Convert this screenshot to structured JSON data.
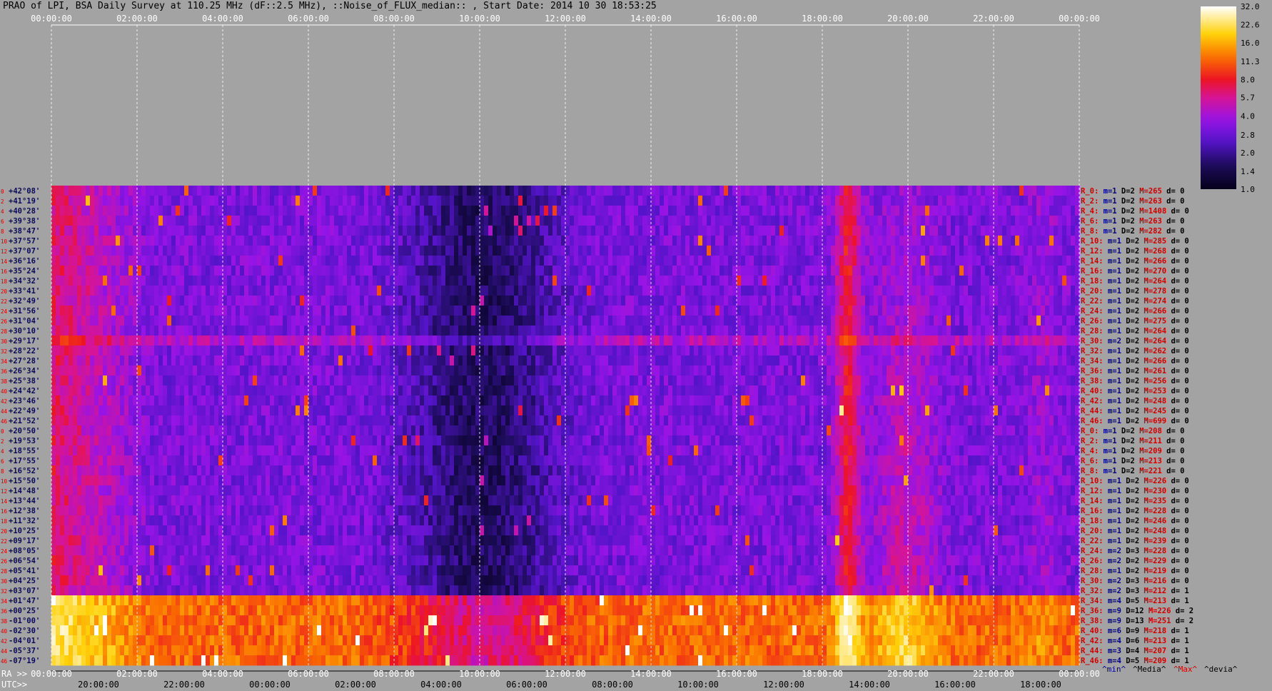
{
  "title": "PRAO of LPI, BSA Daily Survey at 110.25 MHz (dF::2.5 MHz), ::Noise_of_FLUX_median:: , Start Date: 2014 10 30 18:53:25",
  "chart_data": {
    "type": "heatmap",
    "top_time_ticks": [
      "00:00:00",
      "02:00:00",
      "04:00:00",
      "06:00:00",
      "08:00:00",
      "10:00:00",
      "12:00:00",
      "14:00:00",
      "16:00:00",
      "18:00:00",
      "20:00:00",
      "22:00:00",
      "00:00:00"
    ],
    "ra_row_label": "RA >>",
    "ra_ticks": [
      "00:00:00",
      "02:00:00",
      "04:00:00",
      "06:00:00",
      "08:00:00",
      "10:00:00",
      "12:00:00",
      "14:00:00",
      "16:00:00",
      "18:00:00",
      "20:00:00",
      "22:00:00",
      "00:00:00"
    ],
    "utc_row_label": "UTC>>",
    "utc_ticks": [
      "20:00:00",
      "22:00:00",
      "00:00:00",
      "02:00:00",
      "04:00:00",
      "06:00:00",
      "08:00:00",
      "10:00:00",
      "12:00:00",
      "14:00:00",
      "16:00:00",
      "18:00:00"
    ],
    "declinations": [
      "+42°08'",
      "+41°19'",
      "+40°28'",
      "+39°38'",
      "+38°47'",
      "+37°57'",
      "+37°07'",
      "+36°16'",
      "+35°24'",
      "+34°32'",
      "+33°41'",
      "+32°49'",
      "+31°56'",
      "+31°04'",
      "+30°10'",
      "+29°17'",
      "+28°22'",
      "+27°28'",
      "+26°34'",
      "+25°38'",
      "+24°42'",
      "+23°46'",
      "+22°49'",
      "+21°52'",
      "+20°50'",
      "+19°53'",
      "+18°55'",
      "+17°55'",
      "+16°52'",
      "+15°50'",
      "+14°48'",
      "+13°44'",
      "+12°38'",
      "+11°32'",
      "+10°25'",
      "+09°17'",
      "+08°05'",
      "+06°54'",
      "+05°41'",
      "+04°25'",
      "+03°07'",
      "+01°47'",
      "+00°25'",
      "-01°00'",
      "-02°30'",
      "-04°01'",
      "-05°37'",
      "-07°19'"
    ],
    "beam_numbers": [
      "0",
      "2",
      "4",
      "6",
      "8",
      "10",
      "12",
      "14",
      "16",
      "18",
      "20",
      "22",
      "24",
      "26",
      "28",
      "30",
      "32",
      "34",
      "36",
      "38",
      "40",
      "42",
      "44",
      "46",
      "0",
      "2",
      "4",
      "6",
      "8",
      "10",
      "12",
      "14",
      "16",
      "18",
      "20",
      "22",
      "24",
      "26",
      "28",
      "30",
      "32",
      "34",
      "36",
      "38",
      "40",
      "42",
      "44",
      "46"
    ],
    "row_stats": [
      {
        "r": "R_0:",
        "m": "m=1",
        "D": "D=2",
        "M": "M=265",
        "d": "d= 0"
      },
      {
        "r": "R_2:",
        "m": "m=1",
        "D": "D=2",
        "M": "M=263",
        "d": "d= 0"
      },
      {
        "r": "R_4:",
        "m": "m=1",
        "D": "D=2",
        "M": "M=1408",
        "d": "d= 0"
      },
      {
        "r": "R_6:",
        "m": "m=1",
        "D": "D=2",
        "M": "M=263",
        "d": "d= 0"
      },
      {
        "r": "R_8:",
        "m": "m=1",
        "D": "D=2",
        "M": "M=282",
        "d": "d= 0"
      },
      {
        "r": "R_10:",
        "m": "m=1",
        "D": "D=2",
        "M": "M=285",
        "d": "d= 0"
      },
      {
        "r": "R_12:",
        "m": "m=1",
        "D": "D=2",
        "M": "M=268",
        "d": "d= 0"
      },
      {
        "r": "R_14:",
        "m": "m=1",
        "D": "D=2",
        "M": "M=266",
        "d": "d= 0"
      },
      {
        "r": "R_16:",
        "m": "m=1",
        "D": "D=2",
        "M": "M=270",
        "d": "d= 0"
      },
      {
        "r": "R_18:",
        "m": "m=1",
        "D": "D=2",
        "M": "M=264",
        "d": "d= 0"
      },
      {
        "r": "R_20:",
        "m": "m=1",
        "D": "D=2",
        "M": "M=278",
        "d": "d= 0"
      },
      {
        "r": "R_22:",
        "m": "m=1",
        "D": "D=2",
        "M": "M=274",
        "d": "d= 0"
      },
      {
        "r": "R_24:",
        "m": "m=1",
        "D": "D=2",
        "M": "M=266",
        "d": "d= 0"
      },
      {
        "r": "R_26:",
        "m": "m=1",
        "D": "D=2",
        "M": "M=275",
        "d": "d= 0"
      },
      {
        "r": "R_28:",
        "m": "m=1",
        "D": "D=2",
        "M": "M=264",
        "d": "d= 0"
      },
      {
        "r": "R_30:",
        "m": "m=2",
        "D": "D=2",
        "M": "M=264",
        "d": "d= 0"
      },
      {
        "r": "R_32:",
        "m": "m=1",
        "D": "D=2",
        "M": "M=262",
        "d": "d= 0"
      },
      {
        "r": "R_34:",
        "m": "m=1",
        "D": "D=2",
        "M": "M=266",
        "d": "d= 0"
      },
      {
        "r": "R_36:",
        "m": "m=1",
        "D": "D=2",
        "M": "M=261",
        "d": "d= 0"
      },
      {
        "r": "R_38:",
        "m": "m=1",
        "D": "D=2",
        "M": "M=256",
        "d": "d= 0"
      },
      {
        "r": "R_40:",
        "m": "m=1",
        "D": "D=2",
        "M": "M=253",
        "d": "d= 0"
      },
      {
        "r": "R_42:",
        "m": "m=1",
        "D": "D=2",
        "M": "M=248",
        "d": "d= 0"
      },
      {
        "r": "R_44:",
        "m": "m=1",
        "D": "D=2",
        "M": "M=245",
        "d": "d= 0"
      },
      {
        "r": "R_46:",
        "m": "m=1",
        "D": "D=2",
        "M": "M=699",
        "d": "d= 0"
      },
      {
        "r": "R_0:",
        "m": "m=1",
        "D": "D=2",
        "M": "M=208",
        "d": "d= 0"
      },
      {
        "r": "R_2:",
        "m": "m=1",
        "D": "D=2",
        "M": "M=211",
        "d": "d= 0"
      },
      {
        "r": "R_4:",
        "m": "m=1",
        "D": "D=2",
        "M": "M=209",
        "d": "d= 0"
      },
      {
        "r": "R_6:",
        "m": "m=1",
        "D": "D=2",
        "M": "M=213",
        "d": "d= 0"
      },
      {
        "r": "R_8:",
        "m": "m=1",
        "D": "D=2",
        "M": "M=221",
        "d": "d= 0"
      },
      {
        "r": "R_10:",
        "m": "m=1",
        "D": "D=2",
        "M": "M=226",
        "d": "d= 0"
      },
      {
        "r": "R_12:",
        "m": "m=1",
        "D": "D=2",
        "M": "M=230",
        "d": "d= 0"
      },
      {
        "r": "R_14:",
        "m": "m=1",
        "D": "D=2",
        "M": "M=235",
        "d": "d= 0"
      },
      {
        "r": "R_16:",
        "m": "m=1",
        "D": "D=2",
        "M": "M=228",
        "d": "d= 0"
      },
      {
        "r": "R_18:",
        "m": "m=1",
        "D": "D=2",
        "M": "M=246",
        "d": "d= 0"
      },
      {
        "r": "R_20:",
        "m": "m=1",
        "D": "D=2",
        "M": "M=248",
        "d": "d= 0"
      },
      {
        "r": "R_22:",
        "m": "m=1",
        "D": "D=2",
        "M": "M=239",
        "d": "d= 0"
      },
      {
        "r": "R_24:",
        "m": "m=2",
        "D": "D=3",
        "M": "M=228",
        "d": "d= 0"
      },
      {
        "r": "R_26:",
        "m": "m=2",
        "D": "D=2",
        "M": "M=229",
        "d": "d= 0"
      },
      {
        "r": "R_28:",
        "m": "m=1",
        "D": "D=2",
        "M": "M=219",
        "d": "d= 0"
      },
      {
        "r": "R_30:",
        "m": "m=2",
        "D": "D=3",
        "M": "M=216",
        "d": "d= 0"
      },
      {
        "r": "R_32:",
        "m": "m=2",
        "D": "D=3",
        "M": "M=212",
        "d": "d= 1"
      },
      {
        "r": "R_34:",
        "m": "m=4",
        "D": "D=5",
        "M": "M=213",
        "d": "d= 1"
      },
      {
        "r": "R_36:",
        "m": "m=9",
        "D": "D=12",
        "M": "M=226",
        "d": "d= 2"
      },
      {
        "r": "R_38:",
        "m": "m=9",
        "D": "D=13",
        "M": "M=251",
        "d": "d= 2"
      },
      {
        "r": "R_40:",
        "m": "m=6",
        "D": "D=9",
        "M": "M=218",
        "d": "d= 1"
      },
      {
        "r": "R_42:",
        "m": "m=4",
        "D": "D=6",
        "M": "M=213",
        "d": "d= 1"
      },
      {
        "r": "R_44:",
        "m": "m=3",
        "D": "D=4",
        "M": "M=207",
        "d": "d= 1"
      },
      {
        "r": "R_46:",
        "m": "m=4",
        "D": "D=5",
        "M": "M=209",
        "d": "d= 1"
      }
    ],
    "stats_legend": [
      "^min^",
      "^Media^",
      "^Max^",
      "^devia^"
    ],
    "colorbar_ticks": [
      "32.0",
      "22.6",
      "16.0",
      "11.3",
      "8.0",
      "5.7",
      "4.0",
      "2.8",
      "2.0",
      "1.4",
      "1.0"
    ],
    "colorbar_range": [
      1.0,
      32.0
    ],
    "colorbar_scale": "log",
    "colors": {
      "background": "#a3a3a3",
      "grid_line": "#ffffff",
      "dec_label": "#0a0a5a",
      "beam_label": "#d00000",
      "stat_r": "#d00000",
      "stat_m": "#00008b",
      "stat_D": "#000000",
      "stat_M": "#d00000",
      "stat_d": "#000000"
    }
  }
}
